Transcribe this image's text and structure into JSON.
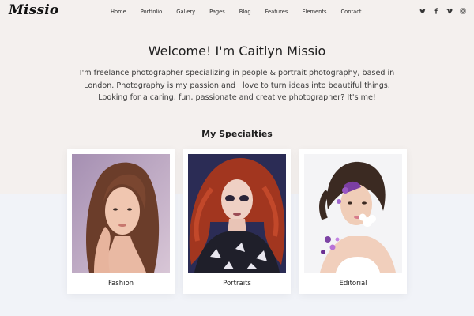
{
  "site": {
    "logo": "Missio"
  },
  "nav": {
    "items": [
      {
        "label": "Home"
      },
      {
        "label": "Portfolio"
      },
      {
        "label": "Gallery"
      },
      {
        "label": "Pages"
      },
      {
        "label": "Blog"
      },
      {
        "label": "Features"
      },
      {
        "label": "Elements"
      },
      {
        "label": "Contact"
      }
    ]
  },
  "social": {
    "icons": [
      "twitter-icon",
      "facebook-icon",
      "vimeo-icon",
      "instagram-icon"
    ]
  },
  "hero": {
    "title": "Welcome! I'm Caitlyn Missio",
    "description": "I'm freelance photographer specializing in people & portrait photography, based in London. Photography is my passion and I love to turn ideas into beautiful things. Looking for a caring, fun, passionate and creative photographer? It's me!"
  },
  "specialties": {
    "title": "My Specialties",
    "cards": [
      {
        "label": "Fashion"
      },
      {
        "label": "Portraits"
      },
      {
        "label": "Editorial"
      }
    ]
  },
  "colors": {
    "hero_background": "#f4f0ee",
    "page_background": "#f1f3f8",
    "text": "#2b2b2b",
    "card_background": "#ffffff"
  }
}
